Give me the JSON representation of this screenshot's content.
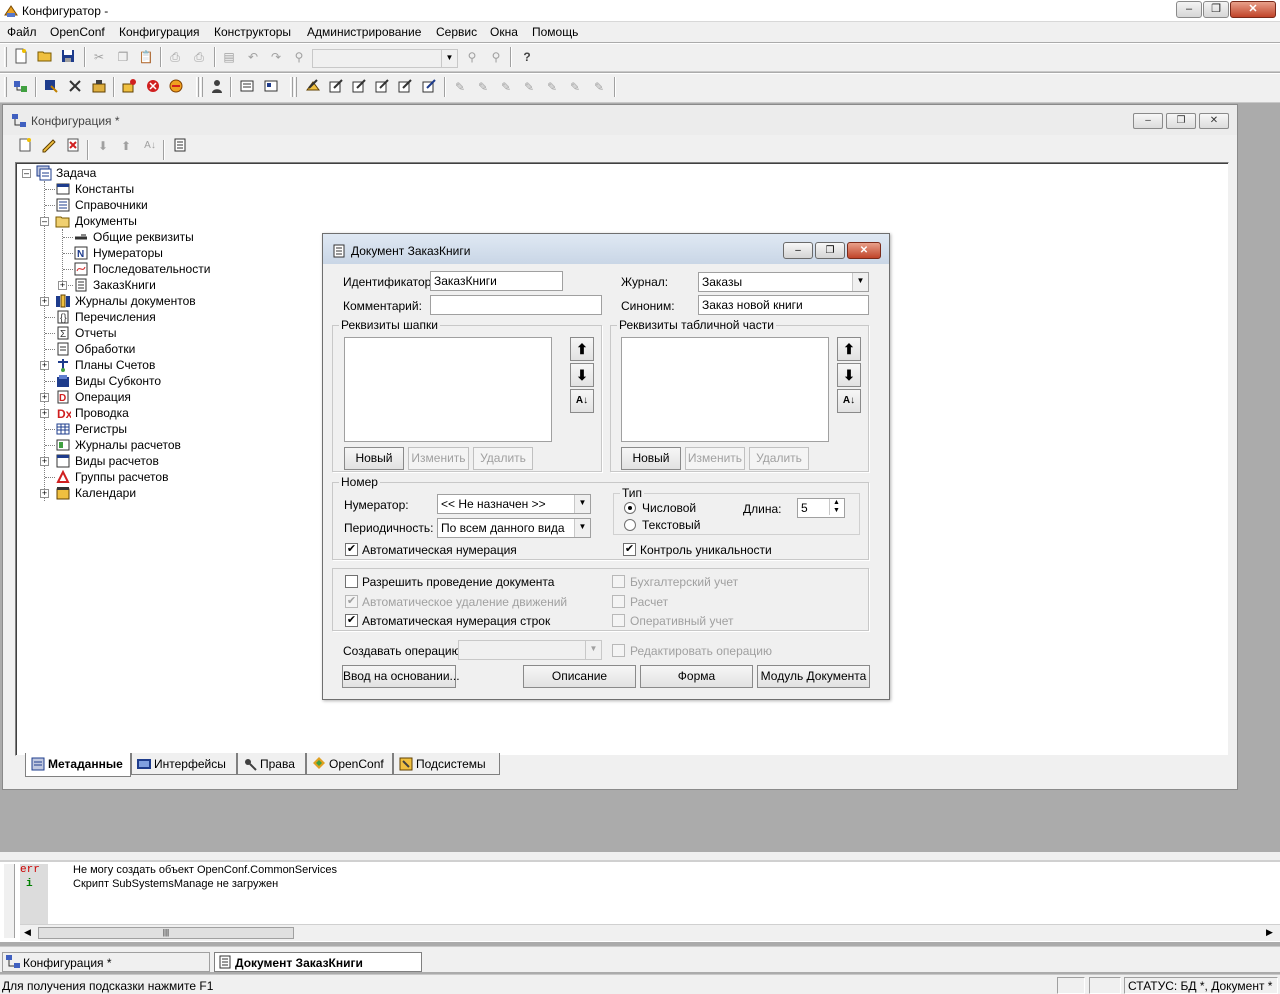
{
  "app": {
    "title": "Конфигуратор -",
    "caption_buttons": {
      "minimize": "–",
      "restore": "❐",
      "close": "✕"
    }
  },
  "menu": [
    "Файл",
    "OpenConf",
    "Конфигурация",
    "Конструкторы",
    "Администрирование",
    "Сервис",
    "Окна",
    "Помощь"
  ],
  "toolbar": {
    "help_glyph": "?",
    "combo_value": ""
  },
  "config_window": {
    "title": "Конфигурация *",
    "tree": {
      "root": "Задача",
      "items": [
        {
          "label": "Константы"
        },
        {
          "label": "Справочники"
        },
        {
          "label": "Документы"
        },
        {
          "label": "Общие реквизиты"
        },
        {
          "label": "Нумераторы"
        },
        {
          "label": "Последовательности"
        },
        {
          "label": "ЗаказКниги"
        },
        {
          "label": "Журналы документов"
        },
        {
          "label": "Перечисления"
        },
        {
          "label": "Отчеты"
        },
        {
          "label": "Обработки"
        },
        {
          "label": "Планы Счетов"
        },
        {
          "label": "Виды Субконто"
        },
        {
          "label": "Операция"
        },
        {
          "label": "Проводка"
        },
        {
          "label": "Регистры"
        },
        {
          "label": "Журналы расчетов"
        },
        {
          "label": "Виды расчетов"
        },
        {
          "label": "Группы расчетов"
        },
        {
          "label": "Календари"
        }
      ]
    },
    "tabs": [
      "Метаданные",
      "Интерфейсы",
      "Права",
      "OpenConf",
      "Подсистемы"
    ]
  },
  "dialog": {
    "title": "Документ ЗаказКниги",
    "identifier_label": "Идентификатор:",
    "identifier_value": "ЗаказКниги",
    "comment_label": "Комментарий:",
    "comment_value": "",
    "journal_label": "Журнал:",
    "journal_value": "Заказы",
    "synonym_label": "Синоним:",
    "synonym_value": "Заказ новой книги",
    "header_group": "Реквизиты шапки",
    "table_group": "Реквизиты табличной части",
    "btn_new": "Новый",
    "btn_edit": "Изменить",
    "btn_delete": "Удалить",
    "number_group": "Номер",
    "numerator_label": "Нумератор:",
    "numerator_value": "<< Не назначен >>",
    "period_label": "Периодичность:",
    "period_value": "По всем данного вида",
    "auto_number": "Автоматическая нумерация",
    "type_group": "Тип",
    "type_numeric": "Числовой",
    "type_text": "Текстовый",
    "length_label": "Длина:",
    "length_value": "5",
    "unique_control": "Контроль уникальности",
    "allow_posting": "Разрешить проведение документа",
    "auto_delete_moves": "Автоматическое удаление движений",
    "auto_row_number": "Автоматическая нумерация строк",
    "accounting": "Бухгалтерский учет",
    "calculation": "Расчет",
    "operational": "Оперативный учет",
    "create_operation_label": "Создавать операцию:",
    "create_operation_value": "",
    "edit_operation": "Редактировать операцию",
    "btn_input_basis": "Ввод на основании...",
    "btn_description": "Описание",
    "btn_form": "Форма",
    "btn_module": "Модуль Документа"
  },
  "messages": [
    {
      "tag": "err",
      "text": "Не   могу создать объект  OpenConf.CommonServices"
    },
    {
      "tag": "i",
      "text": "Скрипт   SubSystemsManage       не загружен"
    }
  ],
  "windows": [
    "Конфигурация *",
    "Документ ЗаказКниги"
  ],
  "status": {
    "hint": "Для получения подсказки нажмите F1",
    "state": "СТАТУС: БД *, Документ *"
  },
  "colors": {
    "accent": "#0a246a",
    "error": "#cc0000",
    "info": "#008000"
  }
}
